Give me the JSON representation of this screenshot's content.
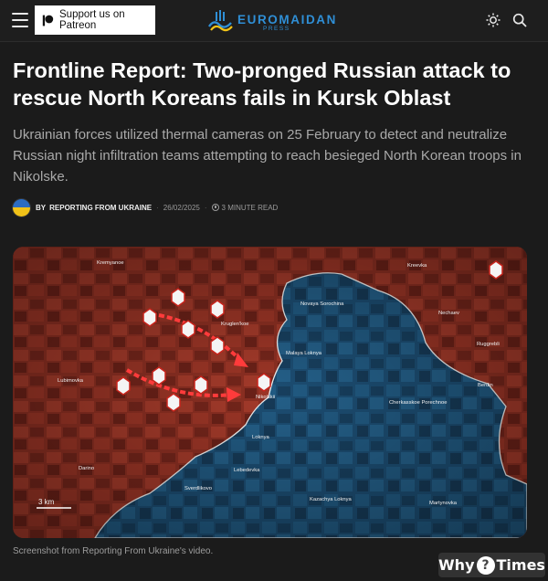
{
  "header": {
    "patreon_label": "Support us on Patreon",
    "logo_text": "EUROMAIDAN",
    "logo_sub": "PRESS",
    "brand_color": "#2f8fd6"
  },
  "article": {
    "title": "Frontline Report: Two-pronged Russian attack to rescue North Koreans fails in Kursk Oblast",
    "subtitle": "Ukrainian forces utilized thermal cameras on 25 February to detect and neutralize Russian night infiltration teams attempting to reach besieged North Korean troops in Nikolske.",
    "by_label": "BY",
    "author": "REPORTING FROM UKRAINE",
    "date": "26/02/2025",
    "read_time": "3 MINUTE READ"
  },
  "map": {
    "labels": {
      "kremyanoe": "Kremyanoe",
      "kreevka": "Kreevka",
      "novaya_sorochina": "Novaya Sorochina",
      "nechaev": "Nechaev",
      "kruglenkoe": "Kruglen'koe",
      "malaya_loknya": "Malaya Loknya",
      "ruggreb": "Ruggrebli",
      "lubimovka": "Lubimovka",
      "nikolskii": "Nikolskii",
      "berdin": "Berdin",
      "cherkasskoe": "Cherkasskoe Porechnoe",
      "loknya": "Loknya",
      "darino": "Darino",
      "lebedevka": "Lebedevka",
      "sverdlikovo": "Sverdlikovo",
      "kazachya_loknya": "Kazachya Loknya",
      "martynovka": "Martynovka",
      "scale": "3 km"
    }
  },
  "caption": "Screenshot from Reporting From Ukraine's video.",
  "watermark": {
    "left": "Why",
    "mark": "?",
    "right": "Times"
  }
}
